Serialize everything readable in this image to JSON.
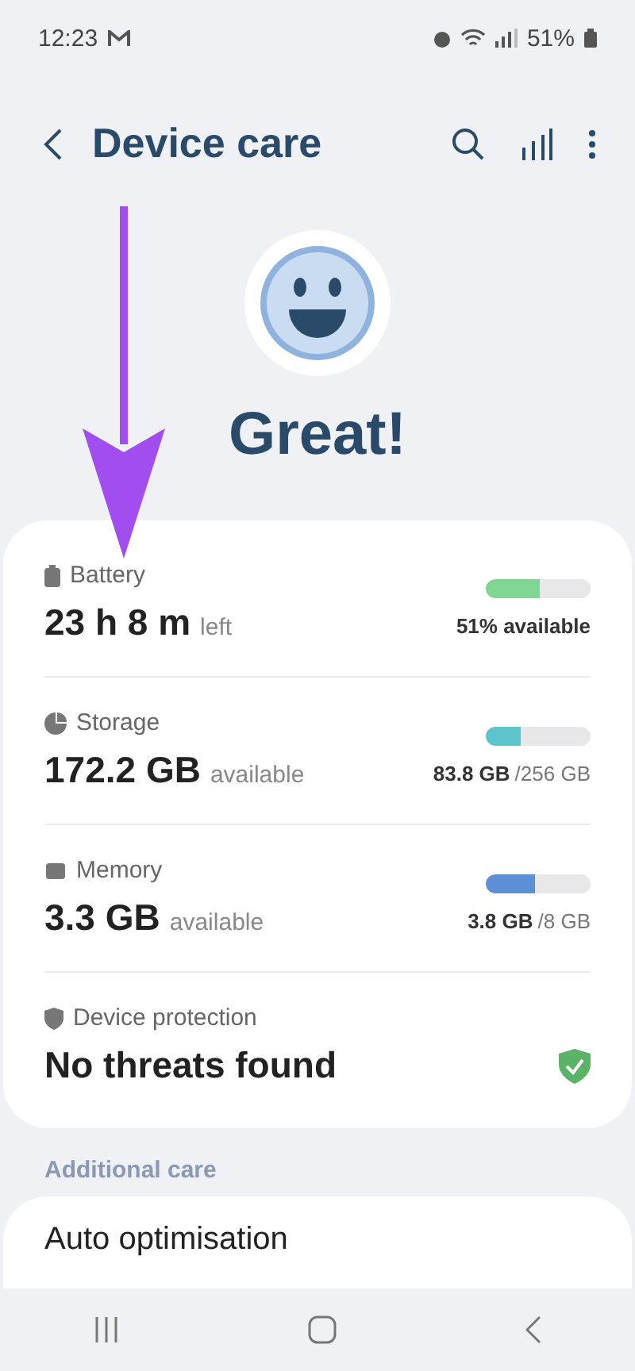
{
  "status_bar": {
    "time": "12:23",
    "battery": "51%"
  },
  "header": {
    "title": "Device care"
  },
  "status": {
    "title": "Great!"
  },
  "items": [
    {
      "kind": "meter",
      "label": "Battery",
      "value": "23 h 8 m",
      "unit": "left",
      "level": 0.51,
      "color": "#7fd692",
      "detail_bold": "51% available"
    },
    {
      "kind": "meter",
      "label": "Storage",
      "value": "172.2 GB",
      "unit": "available",
      "level": 0.33,
      "color": "#5cc4cc",
      "detail_bold": "83.8 GB",
      "detail_rest": "/256 GB"
    },
    {
      "kind": "meter",
      "label": "Memory",
      "value": "3.3 GB",
      "unit": "available",
      "level": 0.47,
      "color": "#5d8fd6",
      "detail_bold": "3.8 GB",
      "detail_rest": "/8 GB"
    },
    {
      "kind": "protection",
      "label": "Device protection",
      "value": "No threats found"
    }
  ],
  "additional": {
    "heading": "Additional care",
    "items": [
      "Auto optimisation"
    ]
  }
}
